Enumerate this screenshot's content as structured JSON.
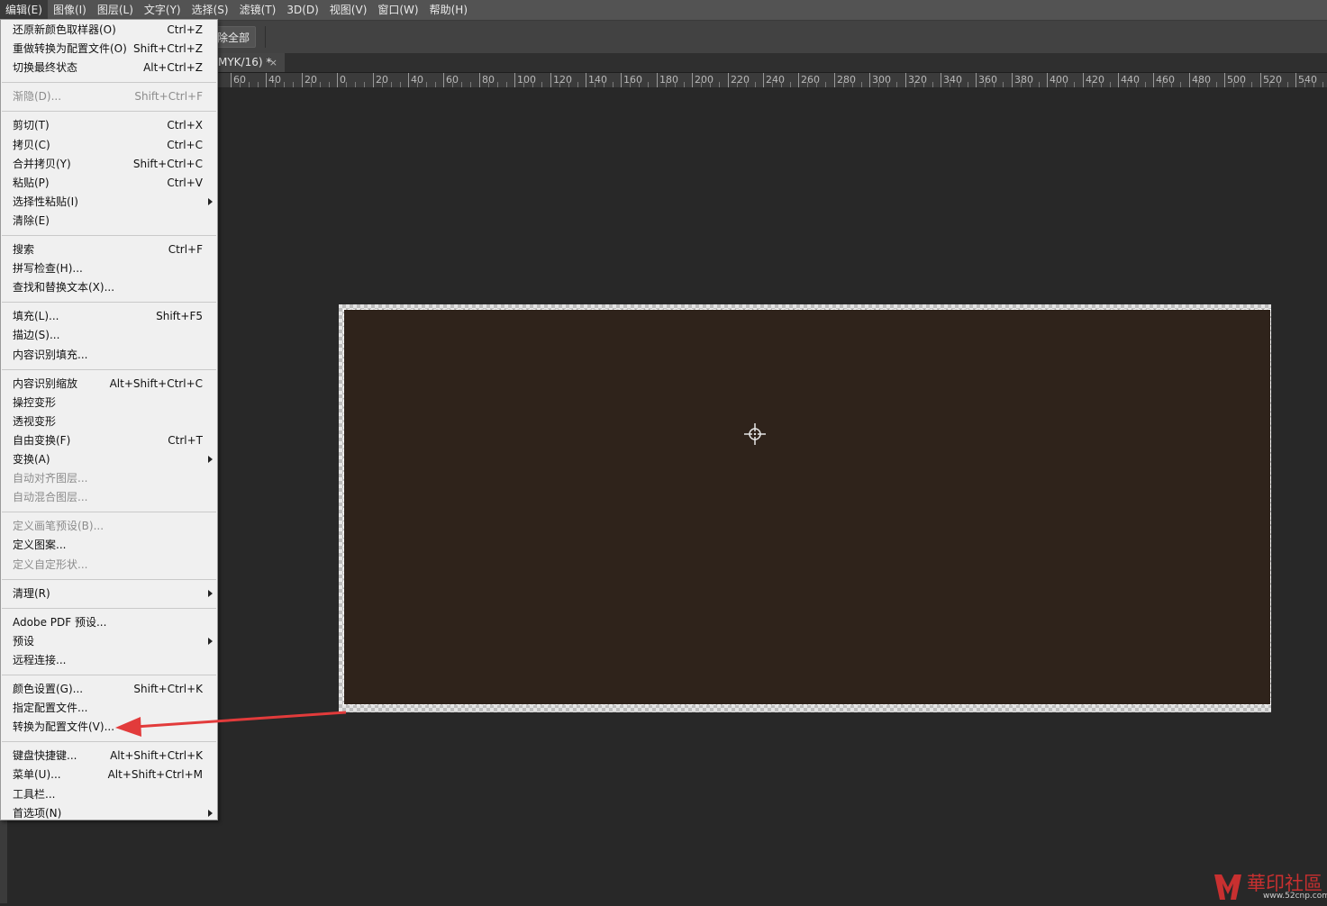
{
  "menubar": {
    "items": [
      {
        "label": "编辑(E)"
      },
      {
        "label": "图像(I)"
      },
      {
        "label": "图层(L)"
      },
      {
        "label": "文字(Y)"
      },
      {
        "label": "选择(S)"
      },
      {
        "label": "滤镜(T)"
      },
      {
        "label": "3D(D)"
      },
      {
        "label": "视图(V)"
      },
      {
        "label": "窗口(W)"
      },
      {
        "label": "帮助(H)"
      }
    ]
  },
  "optionsbar": {
    "button_label": "除全部"
  },
  "document_tab": {
    "title": "MYK/16) *",
    "close": "×"
  },
  "ruler": {
    "labels": [
      "60",
      "40",
      "20",
      "0",
      "20",
      "40",
      "60",
      "80",
      "100",
      "120",
      "140",
      "160",
      "180",
      "200",
      "220",
      "240",
      "260",
      "280",
      "300",
      "320",
      "340",
      "360",
      "380",
      "400",
      "420",
      "440",
      "460",
      "480",
      "500",
      "520",
      "540"
    ]
  },
  "edit_menu": {
    "rows": [
      {
        "label": "还原新颜色取样器(O)",
        "shortcut": "Ctrl+Z",
        "disabled": false,
        "submenu": false
      },
      {
        "label": "重做转换为配置文件(O)",
        "shortcut": "Shift+Ctrl+Z",
        "disabled": false,
        "submenu": false
      },
      {
        "label": "切换最终状态",
        "shortcut": "Alt+Ctrl+Z",
        "disabled": false,
        "submenu": false
      },
      {
        "sep": true
      },
      {
        "label": "渐隐(D)...",
        "shortcut": "Shift+Ctrl+F",
        "disabled": true,
        "submenu": false
      },
      {
        "sep": true
      },
      {
        "label": "剪切(T)",
        "shortcut": "Ctrl+X",
        "disabled": false,
        "submenu": false
      },
      {
        "label": "拷贝(C)",
        "shortcut": "Ctrl+C",
        "disabled": false,
        "submenu": false
      },
      {
        "label": "合并拷贝(Y)",
        "shortcut": "Shift+Ctrl+C",
        "disabled": false,
        "submenu": false
      },
      {
        "label": "粘贴(P)",
        "shortcut": "Ctrl+V",
        "disabled": false,
        "submenu": false
      },
      {
        "label": "选择性粘贴(I)",
        "shortcut": "",
        "disabled": false,
        "submenu": true
      },
      {
        "label": "清除(E)",
        "shortcut": "",
        "disabled": false,
        "submenu": false
      },
      {
        "sep": true
      },
      {
        "label": "搜索",
        "shortcut": "Ctrl+F",
        "disabled": false,
        "submenu": false
      },
      {
        "label": "拼写检查(H)...",
        "shortcut": "",
        "disabled": false,
        "submenu": false
      },
      {
        "label": "查找和替换文本(X)...",
        "shortcut": "",
        "disabled": false,
        "submenu": false
      },
      {
        "sep": true
      },
      {
        "label": "填充(L)...",
        "shortcut": "Shift+F5",
        "disabled": false,
        "submenu": false
      },
      {
        "label": "描边(S)...",
        "shortcut": "",
        "disabled": false,
        "submenu": false
      },
      {
        "label": "内容识别填充...",
        "shortcut": "",
        "disabled": false,
        "submenu": false
      },
      {
        "sep": true
      },
      {
        "label": "内容识别缩放",
        "shortcut": "Alt+Shift+Ctrl+C",
        "disabled": false,
        "submenu": false
      },
      {
        "label": "操控变形",
        "shortcut": "",
        "disabled": false,
        "submenu": false
      },
      {
        "label": "透视变形",
        "shortcut": "",
        "disabled": false,
        "submenu": false
      },
      {
        "label": "自由变换(F)",
        "shortcut": "Ctrl+T",
        "disabled": false,
        "submenu": false
      },
      {
        "label": "变换(A)",
        "shortcut": "",
        "disabled": false,
        "submenu": true
      },
      {
        "label": "自动对齐图层...",
        "shortcut": "",
        "disabled": true,
        "submenu": false
      },
      {
        "label": "自动混合图层...",
        "shortcut": "",
        "disabled": true,
        "submenu": false
      },
      {
        "sep": true
      },
      {
        "label": "定义画笔预设(B)...",
        "shortcut": "",
        "disabled": true,
        "submenu": false
      },
      {
        "label": "定义图案...",
        "shortcut": "",
        "disabled": false,
        "submenu": false
      },
      {
        "label": "定义自定形状...",
        "shortcut": "",
        "disabled": true,
        "submenu": false
      },
      {
        "sep": true
      },
      {
        "label": "清理(R)",
        "shortcut": "",
        "disabled": false,
        "submenu": true
      },
      {
        "sep": true
      },
      {
        "label": "Adobe PDF 预设...",
        "shortcut": "",
        "disabled": false,
        "submenu": false
      },
      {
        "label": "预设",
        "shortcut": "",
        "disabled": false,
        "submenu": true
      },
      {
        "label": "远程连接...",
        "shortcut": "",
        "disabled": false,
        "submenu": false
      },
      {
        "sep": true
      },
      {
        "label": "颜色设置(G)...",
        "shortcut": "Shift+Ctrl+K",
        "disabled": false,
        "submenu": false
      },
      {
        "label": "指定配置文件...",
        "shortcut": "",
        "disabled": false,
        "submenu": false
      },
      {
        "label": "转换为配置文件(V)...",
        "shortcut": "",
        "disabled": false,
        "submenu": false
      },
      {
        "sep": true
      },
      {
        "label": "键盘快捷键...",
        "shortcut": "Alt+Shift+Ctrl+K",
        "disabled": false,
        "submenu": false
      },
      {
        "label": "菜单(U)...",
        "shortcut": "Alt+Shift+Ctrl+M",
        "disabled": false,
        "submenu": false
      },
      {
        "label": "工具栏...",
        "shortcut": "",
        "disabled": false,
        "submenu": false
      },
      {
        "label": "首选项(N)",
        "shortcut": "",
        "disabled": false,
        "submenu": true
      }
    ]
  },
  "canvas": {
    "fill_color": "#2f231b",
    "cursor_icon": "crosshair-icon"
  },
  "annotation": {
    "color": "#e23b3b",
    "points_to": "转换为配置文件(V)..."
  },
  "watermark": {
    "text": "華印社區",
    "sub": "www.52cnp.com"
  }
}
